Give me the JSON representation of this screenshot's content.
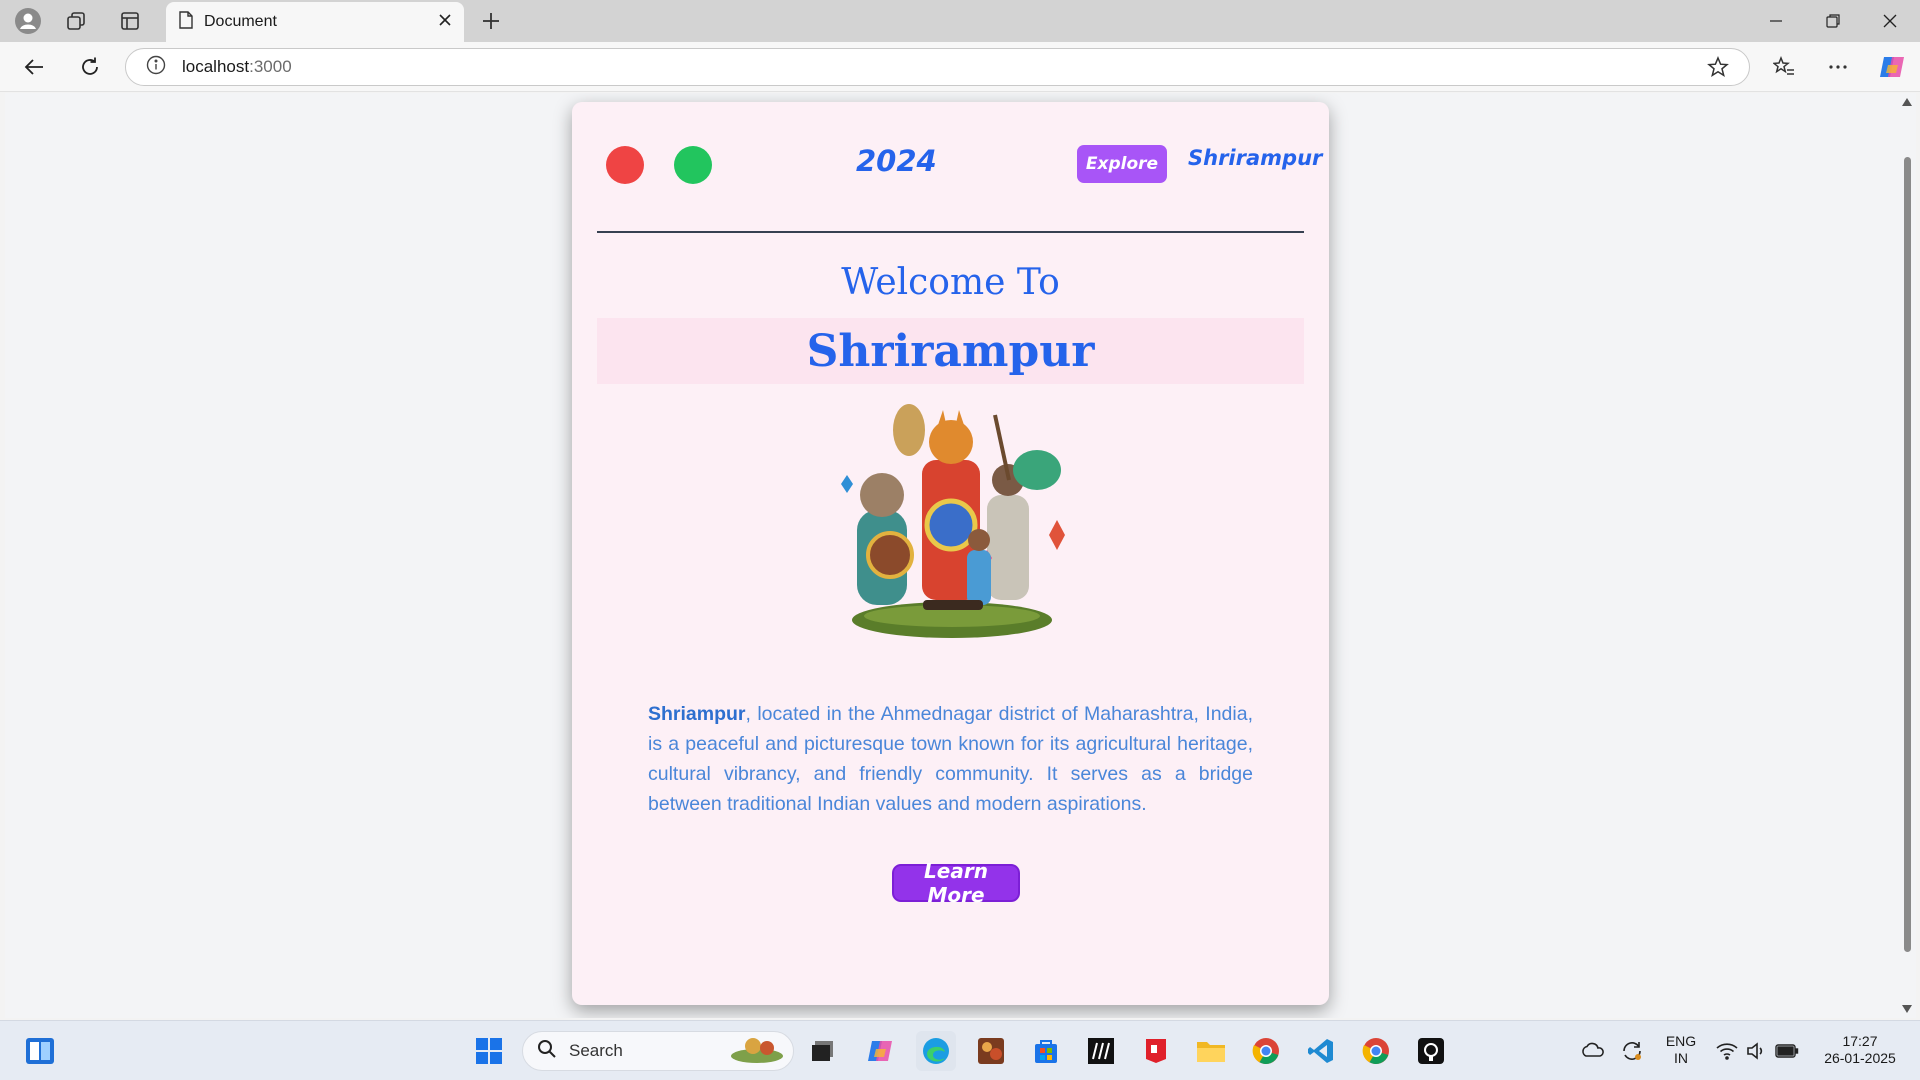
{
  "browser": {
    "tab_title": "Document",
    "url_host": "localhost",
    "url_port": ":3000"
  },
  "page": {
    "year": "2024",
    "explore_label": "Explore",
    "brand": "Shrirampur",
    "welcome": "Welcome To",
    "title": "Shrirampur",
    "description_bold": "Shriampur",
    "description_rest": ", located in the Ahmednagar district of Maharashtra, India, is a peaceful and picturesque town known for its agricultural heritage, cultural vibrancy, and friendly community. It serves as a bridge between traditional Indian values and modern aspirations.",
    "learn_more_label": "Learn More"
  },
  "taskbar": {
    "search_label": "Search",
    "language": "ENG",
    "region": "IN",
    "time": "17:27",
    "date": "26-01-2025"
  },
  "colors": {
    "accent_blue": "#2563eb",
    "button_purple": "#a855f7",
    "dot_red": "#ef4444",
    "dot_green": "#22c55e",
    "card_bg": "#fdf0f6"
  }
}
